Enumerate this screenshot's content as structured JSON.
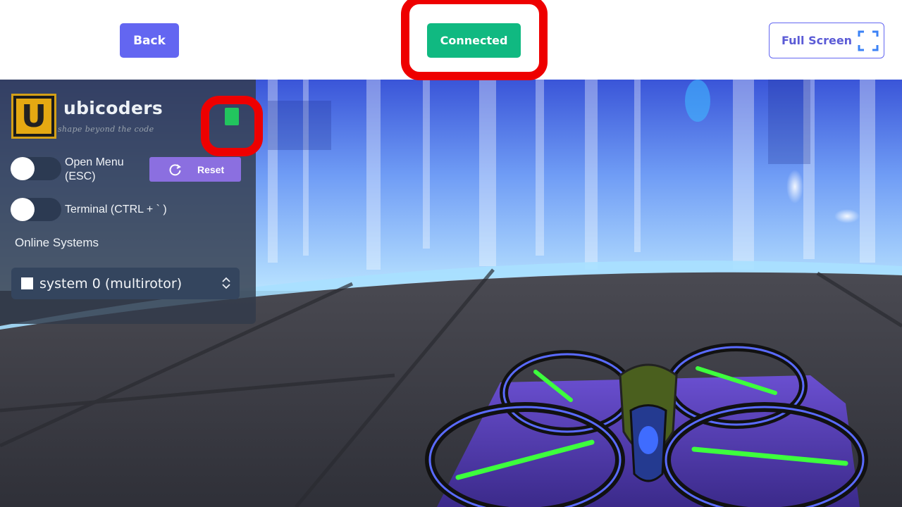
{
  "topbar": {
    "back_label": "Back",
    "connected_label": "Connected",
    "fullscreen_label": "Full Screen"
  },
  "panel": {
    "brand_letter": "U",
    "brand_name": "ubicoders",
    "brand_tagline": "shape beyond the code",
    "open_menu_label": "Open Menu\n(ESC)",
    "reset_label": "Reset",
    "terminal_label": "Terminal (CTRL + ` )",
    "online_systems_label": "Online Systems",
    "selected_system": "system 0 (multirotor)",
    "connection_status_color": "#22c55e"
  },
  "icons": {
    "fullscreen": "fullscreen-corners-icon",
    "reset": "refresh-icon",
    "select": "chevron-up-down-icon"
  },
  "colors": {
    "back": "#6366f1",
    "connected": "#10b981",
    "highlight": "#ee0000",
    "reset": "#8b6fe0"
  }
}
